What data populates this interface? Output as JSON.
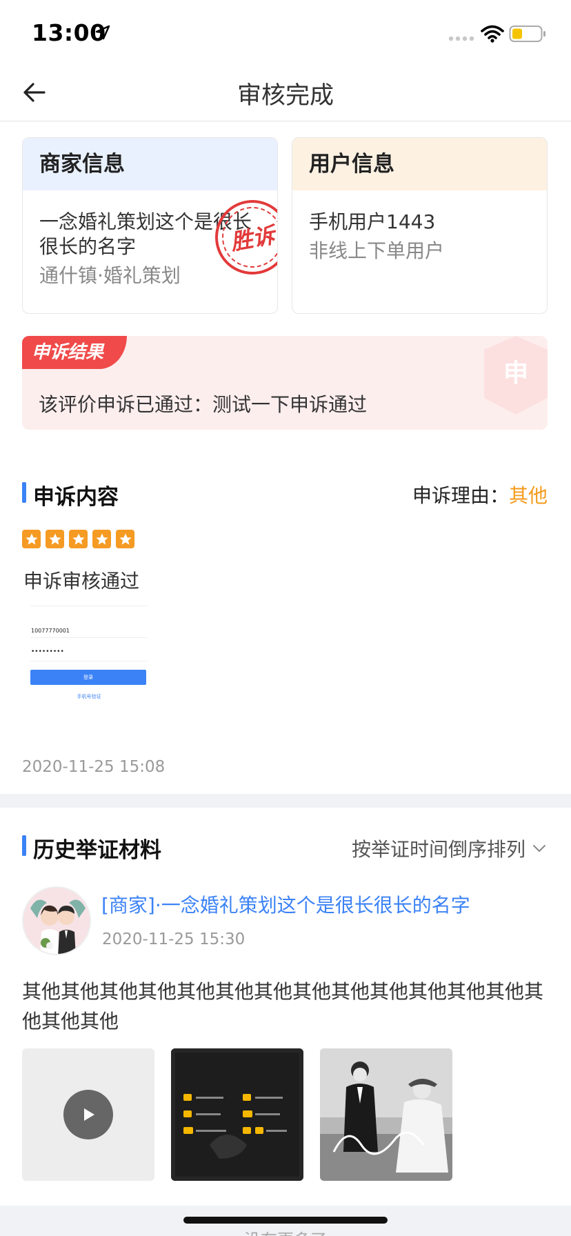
{
  "status_bar": {
    "time": "13:00"
  },
  "nav": {
    "title": "审核完成"
  },
  "merchant_card": {
    "header": "商家信息",
    "name": "一念婚礼策划这个是很长很长的名字",
    "sub": "通什镇·婚礼策划",
    "stamp": "胜诉"
  },
  "user_card": {
    "header": "用户信息",
    "name": "手机用户1443",
    "sub": "非线上下单用户"
  },
  "result": {
    "tag": "申诉结果",
    "text": "该评价申诉已通过：测试一下申诉通过",
    "badge": "申"
  },
  "appeal": {
    "title": "申诉内容",
    "reason_label": "申诉理由：",
    "reason_value": "其他",
    "rating": 5,
    "text": "申诉审核通过",
    "time": "2020-11-25 15:08",
    "thumb": {
      "account": "10077770001",
      "password": "•••••••••",
      "button": "登录",
      "link": "手机号验证"
    }
  },
  "history": {
    "title": "历史举证材料",
    "sort_label": "按举证时间倒序排列",
    "evidence": {
      "author": "[商家]·一念婚礼策划这个是很长很长的名字",
      "time": "2020-11-25 15:30",
      "text": "其他其他其他其他其他其他其他其他其他其他其他其他其他其他其他其他"
    }
  },
  "footer": {
    "no_more": "没有更多了"
  },
  "colors": {
    "accent_blue": "#3b82f6",
    "orange": "#f59a1a",
    "red": "#f04a4a"
  }
}
